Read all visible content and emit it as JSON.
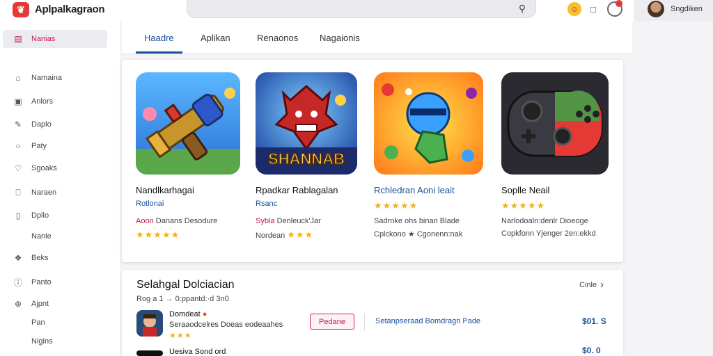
{
  "app": {
    "title": "Aplpalkagraon",
    "logo_letter": "⌄"
  },
  "user": {
    "name": "Sngdiken"
  },
  "sidebar": {
    "items": [
      {
        "label": "Nanias",
        "icon": "store-icon",
        "glyph": "▤",
        "active": true
      },
      {
        "label": "Namaina",
        "icon": "bag-icon",
        "glyph": "⌂"
      },
      {
        "label": "Anlors",
        "icon": "box-icon",
        "glyph": "▣"
      },
      {
        "label": "Daplo",
        "icon": "pen-icon",
        "glyph": "✎"
      },
      {
        "label": "Paty",
        "icon": "circle-icon",
        "glyph": "○"
      },
      {
        "label": "Sgoaks",
        "icon": "heart-icon",
        "glyph": "♡"
      },
      {
        "label": "Naraen",
        "icon": "grid-icon",
        "glyph": "⎕"
      },
      {
        "label": "Dpilo",
        "icon": "file-icon",
        "glyph": "▯"
      },
      {
        "label": "Nanle",
        "icon": "",
        "glyph": ""
      },
      {
        "label": "Beks",
        "icon": "puzzle-icon",
        "glyph": "❖"
      },
      {
        "label": "Panto",
        "icon": "info-icon",
        "glyph": "ⓘ"
      },
      {
        "label": "Ajpnt",
        "icon": "globe-icon",
        "glyph": "⊕"
      },
      {
        "label": "Pan",
        "icon": "",
        "glyph": ""
      },
      {
        "label": "Nigins",
        "icon": "",
        "glyph": ""
      }
    ]
  },
  "tabs": [
    {
      "label": "Haadre",
      "active": true
    },
    {
      "label": "Aplikan"
    },
    {
      "label": "Renaonos"
    },
    {
      "label": "Nagaionis"
    }
  ],
  "featured": [
    {
      "title": "Nandlkarhagai",
      "subtitle": "Rotlonai",
      "desc_accent": "Aoon",
      "desc": " Danans Desodure",
      "rating_stars": "★★★★★",
      "rating": 5
    },
    {
      "title": "Rpadkar Rablagalan",
      "subtitle": "Rsanc",
      "desc_accent": "Sybla",
      "desc": " Denleuck'Jar",
      "desc2": "Nordean",
      "rating_stars": "★★★",
      "rating": 3,
      "art_text": "SHANNAB"
    },
    {
      "title": "Rchledran Aoni leait",
      "rating_stars": "★★★★★",
      "rating": 5,
      "desc": "Sadrnke ohs binan Blade",
      "desc2": "Cplckono ★ Cgonenn:nak"
    },
    {
      "title": "Soplle Neail",
      "rating_stars": "★★★★★",
      "rating": 5,
      "desc": "Narlodoaln:denlr Dioeoge",
      "desc2": "Copkfonn Yjenger 2en:ekkd"
    }
  ],
  "section": {
    "title": "Selahgal Dolciacian",
    "subtitle": "Rog  a  1  →  0:ppantd:·d 3n0",
    "see_all": "Cinle",
    "items": [
      {
        "name": "Domdeat",
        "meta": "Seraaodcelres Doeas eodeaahes",
        "stars": "★★★",
        "button": "Pedane",
        "link": "Setanpseraad Bomdragn Pade",
        "price": "$01. S"
      },
      {
        "name": "Uesiva Sond ord",
        "price": "$0. 0"
      }
    ]
  },
  "colors": {
    "accent": "#1a4f9c",
    "brand": "#c2185b",
    "logo": "#e53935",
    "star": "#f2b01e"
  }
}
